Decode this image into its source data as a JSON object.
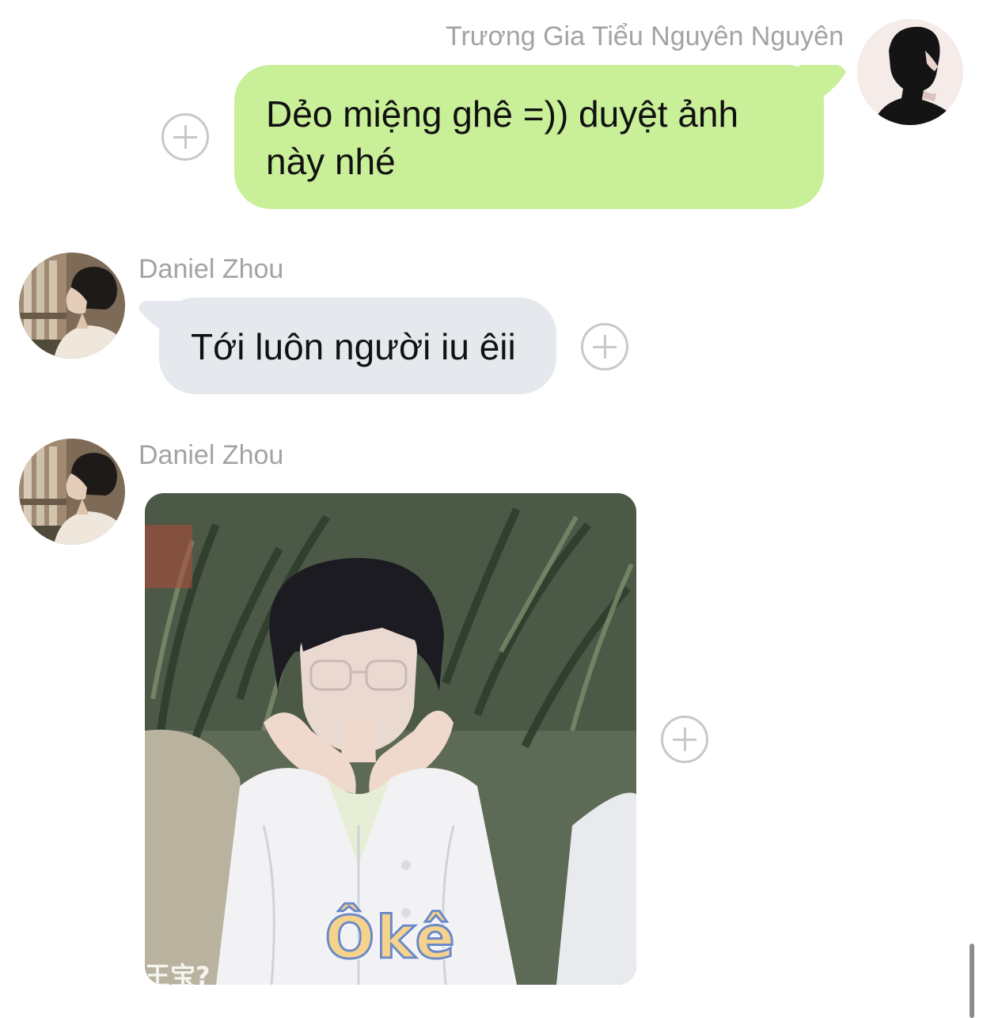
{
  "messages": [
    {
      "direction": "outgoing",
      "sender": "Trương Gia Tiểu Nguyên Nguyên",
      "type": "text",
      "text_line1": "Dẻo miệng ghê =)) duyệt ảnh",
      "text_line2": "này nhé"
    },
    {
      "direction": "incoming",
      "sender": "Daniel Zhou",
      "type": "text",
      "text": "Tới luôn người iu êii"
    },
    {
      "direction": "incoming",
      "sender": "Daniel Zhou",
      "type": "sticker",
      "caption": "Ôkê"
    }
  ],
  "icons": {
    "add_reaction": "plus-circle-icon"
  },
  "colors": {
    "outgoing_bubble": "#c9ef98",
    "incoming_bubble": "#e5e8ec",
    "sender_name": "#a3a3a3",
    "add_button": "#c8c8c8"
  }
}
